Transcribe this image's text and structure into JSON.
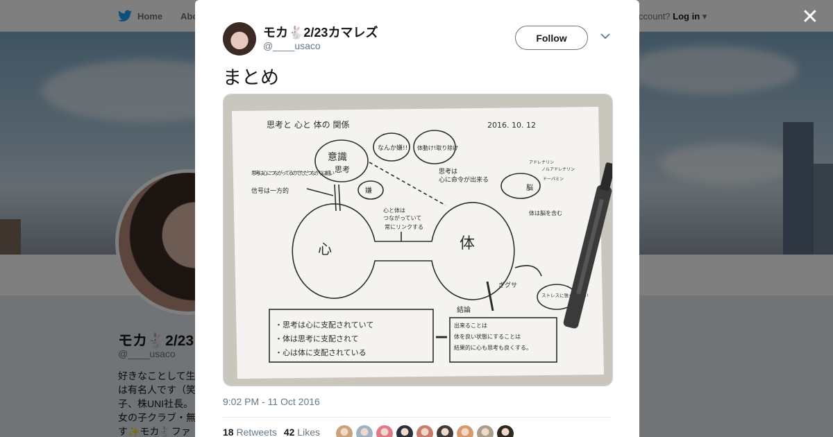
{
  "nav": {
    "home_label": "Home",
    "about_label": "Abo",
    "account_prefix": "ccount?",
    "login_label": "Log in"
  },
  "profile": {
    "name": "モカ🐇2/23",
    "handle": "@____usaco",
    "bio_lines": [
      "好きなことして生",
      "は有名人です（笑",
      "子、株UNI社長。",
      "女の子クラブ・無",
      "す✨モカ🐇ファ"
    ]
  },
  "tweet": {
    "author_name": "モカ🐇2/23カマレズ",
    "author_handle": "@____usaco",
    "follow_label": "Follow",
    "text": "まとめ",
    "timestamp": "9:02 PM - 11 Oct 2016",
    "retweets_count": "18",
    "retweets_label": "Retweets",
    "likes_count": "42",
    "likes_label": "Likes"
  },
  "drawing": {
    "heading": "思考と 心と 体の 関係",
    "date": "2016. 10. 12",
    "ishiki": "意識",
    "shikou": "思考",
    "bubble1": "なんか嫌!!",
    "bubble2": "体動け!取り除け",
    "bubble3": "嫌",
    "left_note1": "思考は心につながってるのでただ つながりは細い",
    "left_note2": "信号は一方的",
    "right_note1": "思考は",
    "right_note2": "心に命令が出来る",
    "mid_note1": "心と体は",
    "mid_note2": "つながっていて",
    "mid_note3": "常にリンクする",
    "kokoro": "心",
    "karada": "体",
    "brain_note": "体は脳を含む",
    "brain_label": "脳",
    "chem1": "アドレナリン",
    "chem2": "ノルアドレナリン",
    "chem3": "ドーパミン",
    "stab": "ぎグサ",
    "stress": "ストレスに強くなれる!",
    "conclusion": "結論",
    "box_left_1": "・思考は心に支配されていて",
    "box_left_2": "・体は思考に支配されて",
    "box_left_3": "・心は体に支配されている",
    "box_right_1": "出来ることは",
    "box_right_2": "体を良い状態にすることは",
    "box_right_3": "結果的に心も思考も良くする。"
  },
  "colors": {
    "link": "#1da1f2",
    "text": "#14171a",
    "muted": "#657786",
    "paper": "#f4f3ef",
    "ink": "#2b2b2b"
  },
  "likers": [
    "#c9a27e",
    "#9fb3c4",
    "#e07a8a",
    "#2b2f3a",
    "#c97a6a",
    "#3c3c3c",
    "#d89a6a",
    "#a8a08c",
    "#2e2a20"
  ]
}
